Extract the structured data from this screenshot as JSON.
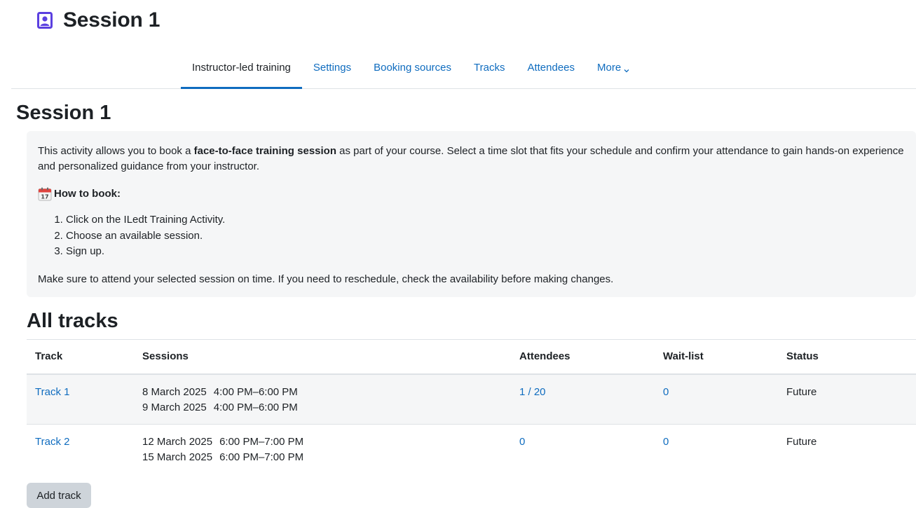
{
  "header": {
    "title": "Session 1",
    "icon": "activity-person-icon",
    "icon_color": "#5b40e0"
  },
  "nav": {
    "tabs": [
      {
        "label": "Instructor-led training",
        "active": true
      },
      {
        "label": "Settings",
        "active": false
      },
      {
        "label": "Booking sources",
        "active": false
      },
      {
        "label": "Tracks",
        "active": false
      },
      {
        "label": "Attendees",
        "active": false
      },
      {
        "label": "More",
        "active": false,
        "icon": "chevron-down-icon"
      }
    ]
  },
  "main": {
    "section_title": "Session 1",
    "intro": {
      "p1_pre": "This activity allows you to book a ",
      "p1_bold": "face-to-face training session",
      "p1_post": " as part of your course. Select a time slot that fits your schedule and confirm your attendance to gain hands-on experience and personalized guidance from your instructor.",
      "howto_icon": "calendar-icon",
      "howto_label": "How to book:",
      "steps": [
        "Click on the ILedt Training Activity.",
        "Choose an available session.",
        "Sign up."
      ],
      "closing": "Make sure to attend your selected session on time. If you need to reschedule, check the availability before making changes."
    },
    "tracks": {
      "title": "All tracks",
      "columns": [
        "Track",
        "Sessions",
        "Attendees",
        "Wait-list",
        "Status"
      ],
      "rows": [
        {
          "track": "Track 1",
          "sessions": [
            {
              "date": "8 March 2025",
              "time": "4:00 PM–6:00 PM"
            },
            {
              "date": "9 March 2025",
              "time": "4:00 PM–6:00 PM"
            }
          ],
          "attendees": "1 / 20",
          "waitlist": "0",
          "status": "Future"
        },
        {
          "track": "Track 2",
          "sessions": [
            {
              "date": "12 March 2025",
              "time": "6:00 PM–7:00 PM"
            },
            {
              "date": "15 March 2025",
              "time": "6:00 PM–7:00 PM"
            }
          ],
          "attendees": "0",
          "waitlist": "0",
          "status": "Future"
        }
      ],
      "add_button": "Add track"
    }
  },
  "colors": {
    "link": "#0f6cbf",
    "text": "#1d2125",
    "panel_bg": "#f5f6f7",
    "button_bg": "#ced4da"
  }
}
